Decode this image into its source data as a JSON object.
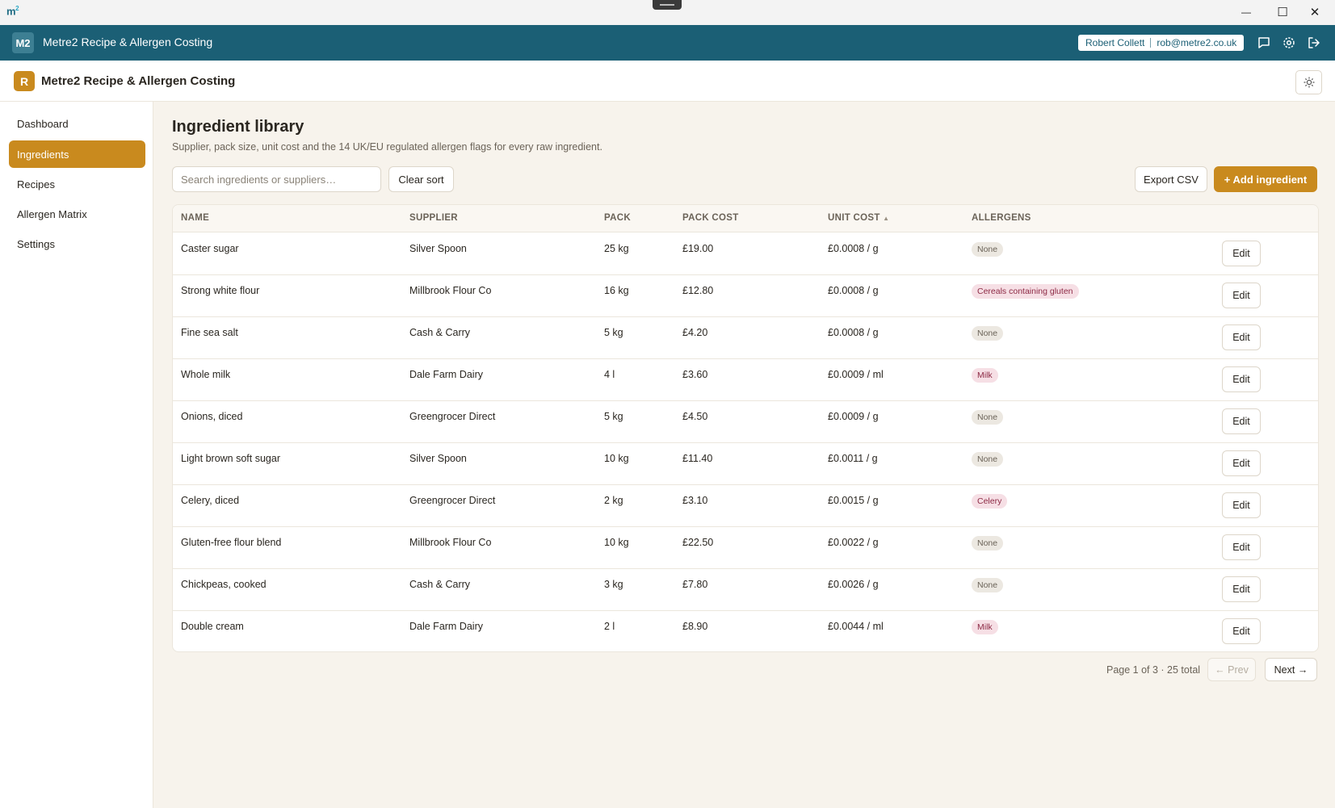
{
  "os": {
    "logo": "m",
    "logo_sup": "2",
    "minimize": "—",
    "maximize": "☐",
    "close": "✕"
  },
  "app": {
    "logo": "M2",
    "title": "Metre2 Recipe & Allergen Costing"
  },
  "user": {
    "name": "Robert Collett",
    "email": "rob@metre2.co.uk"
  },
  "brand": {
    "badge": "R",
    "name": "Metre2 Recipe & Allergen Costing"
  },
  "sidebar": {
    "items": [
      {
        "label": "Dashboard",
        "active": false
      },
      {
        "label": "Ingredients",
        "active": true
      },
      {
        "label": "Recipes",
        "active": false
      },
      {
        "label": "Allergen Matrix",
        "active": false
      },
      {
        "label": "Settings",
        "active": false
      }
    ]
  },
  "page": {
    "title": "Ingredient library",
    "subtitle": "Supplier, pack size, unit cost and the 14 UK/EU regulated allergen flags for every raw ingredient."
  },
  "toolbar": {
    "search_placeholder": "Search ingredients or suppliers…",
    "search_value": "",
    "clear_sort": "Clear sort",
    "export_csv": "Export CSV",
    "add_ingredient": "+ Add ingredient"
  },
  "table": {
    "headers": [
      "NAME",
      "SUPPLIER",
      "PACK",
      "PACK COST",
      "UNIT COST",
      "ALLERGENS"
    ],
    "sort_indicator": "▲",
    "edit_label": "Edit",
    "rows": [
      {
        "name": "Caster sugar",
        "supplier": "Silver Spoon",
        "pack": "25 kg",
        "pack_cost": "£19.00",
        "unit_cost": "£0.0008 / g",
        "allergen": "None",
        "allergen_type": "none"
      },
      {
        "name": "Strong white flour",
        "supplier": "Millbrook Flour Co",
        "pack": "16 kg",
        "pack_cost": "£12.80",
        "unit_cost": "£0.0008 / g",
        "allergen": "Cereals containing gluten",
        "allergen_type": "allergen"
      },
      {
        "name": "Fine sea salt",
        "supplier": "Cash & Carry",
        "pack": "5 kg",
        "pack_cost": "£4.20",
        "unit_cost": "£0.0008 / g",
        "allergen": "None",
        "allergen_type": "none"
      },
      {
        "name": "Whole milk",
        "supplier": "Dale Farm Dairy",
        "pack": "4 l",
        "pack_cost": "£3.60",
        "unit_cost": "£0.0009 / ml",
        "allergen": "Milk",
        "allergen_type": "allergen"
      },
      {
        "name": "Onions, diced",
        "supplier": "Greengrocer Direct",
        "pack": "5 kg",
        "pack_cost": "£4.50",
        "unit_cost": "£0.0009 / g",
        "allergen": "None",
        "allergen_type": "none"
      },
      {
        "name": "Light brown soft sugar",
        "supplier": "Silver Spoon",
        "pack": "10 kg",
        "pack_cost": "£11.40",
        "unit_cost": "£0.0011 / g",
        "allergen": "None",
        "allergen_type": "none"
      },
      {
        "name": "Celery, diced",
        "supplier": "Greengrocer Direct",
        "pack": "2 kg",
        "pack_cost": "£3.10",
        "unit_cost": "£0.0015 / g",
        "allergen": "Celery",
        "allergen_type": "allergen"
      },
      {
        "name": "Gluten-free flour blend",
        "supplier": "Millbrook Flour Co",
        "pack": "10 kg",
        "pack_cost": "£22.50",
        "unit_cost": "£0.0022 / g",
        "allergen": "None",
        "allergen_type": "none"
      },
      {
        "name": "Chickpeas, cooked",
        "supplier": "Cash & Carry",
        "pack": "3 kg",
        "pack_cost": "£7.80",
        "unit_cost": "£0.0026 / g",
        "allergen": "None",
        "allergen_type": "none"
      },
      {
        "name": "Double cream",
        "supplier": "Dale Farm Dairy",
        "pack": "2 l",
        "pack_cost": "£8.90",
        "unit_cost": "£0.0044 / ml",
        "allergen": "Milk",
        "allergen_type": "allergen"
      }
    ]
  },
  "pager": {
    "info": "Page 1 of 3 · 25 total",
    "prev": "← Prev",
    "next": "Next →"
  },
  "colors": {
    "header": "#1b5f75",
    "accent": "#c98a1e",
    "page_bg": "#f7f3ec",
    "allergen_badge": "#f6dfe5"
  }
}
